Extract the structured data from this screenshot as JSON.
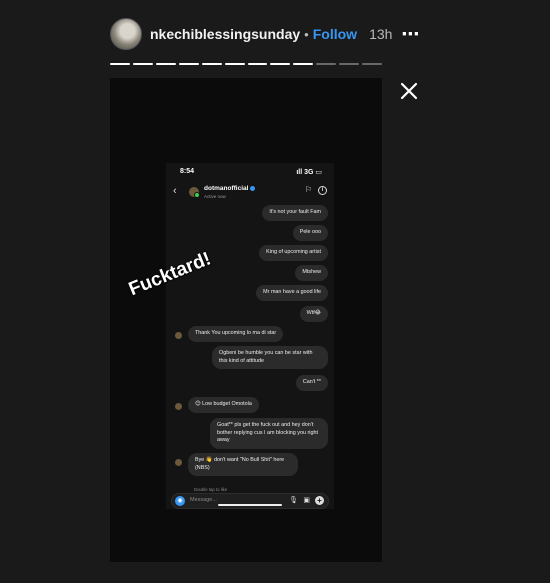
{
  "header": {
    "username": "nkechiblessingsunday",
    "separator": "•",
    "follow_label": "Follow",
    "time_ago": "13h",
    "more_icon": "⋯"
  },
  "progress": {
    "total_segments": 12,
    "completed_segments": 9
  },
  "sticker_text": "Fucktard!",
  "phone": {
    "status_time": "8:54",
    "status_right": "ıll 3G ▭",
    "chat_name": "dotmanofficial",
    "active_status": "Active now",
    "composer_placeholder": "Message...",
    "reaction_note": "Double tap to like",
    "messages": [
      {
        "side": "right",
        "text": "It's not your fault Fam"
      },
      {
        "side": "right",
        "text": "Pele ooo"
      },
      {
        "side": "right",
        "text": "King of upcoming artist"
      },
      {
        "side": "right",
        "text": "Mtshew"
      },
      {
        "side": "right",
        "text": "Mr man have a good life"
      },
      {
        "side": "right",
        "text": "Wtf😂"
      },
      {
        "side": "left",
        "text": "Thank You upcoming lo ma di star"
      },
      {
        "side": "right",
        "text": "Ogbeni be humble you can be star with this kind of attitude"
      },
      {
        "side": "right",
        "text": "Can't **"
      },
      {
        "side": "left",
        "text": "😊 Low budget Omotola"
      },
      {
        "side": "right",
        "text": "Goat** pls get the fuck out and hey don't bother replying cus I am blocking you right away"
      },
      {
        "side": "left",
        "text": "Bye 👋 don't want \"No Bull Shit\" here (NBS)"
      }
    ]
  }
}
